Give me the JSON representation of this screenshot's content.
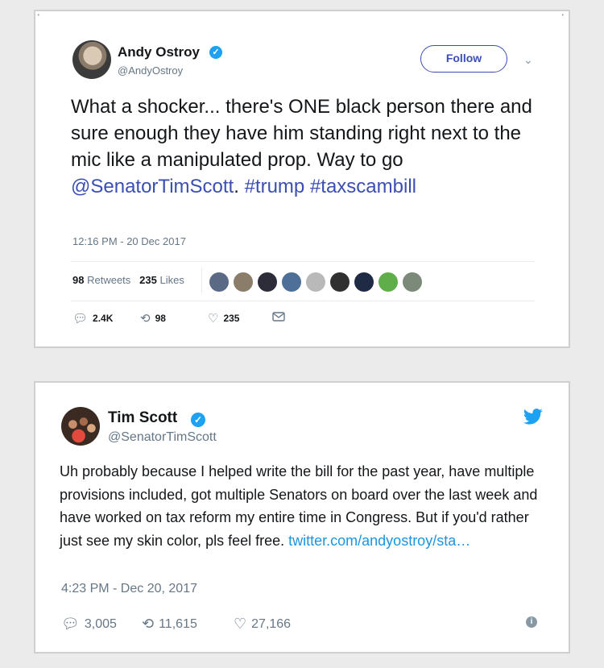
{
  "tweet1": {
    "name": "Andy Ostroy",
    "handle": "@AndyOstroy",
    "follow_label": "Follow",
    "text_plain": "What a shocker... there's ONE black person there and sure enough they have him standing right next to the mic like a manipulated prop. Way to go ",
    "mention": "@SenatorTimScott",
    "text_sep": ". ",
    "hashtag1": "#trump",
    "hashtag2": "#taxscambill",
    "timestamp": "12:16 PM - 20 Dec 2017",
    "retweets_count": "98",
    "retweets_label": "Retweets",
    "likes_count": "235",
    "likes_label": "Likes",
    "actions": {
      "replies": "2.4K",
      "retweets": "98",
      "likes": "235"
    },
    "liker_avatar_colors": [
      "#5a6a85",
      "#8a7d6a",
      "#2d2d3a",
      "#4d6f98",
      "#b9b9b9",
      "#303030",
      "#1f2a44",
      "#5fae4a",
      "#7c8a7a"
    ]
  },
  "tweet2": {
    "name": "Tim Scott",
    "handle": "@SenatorTimScott",
    "text": "Uh probably because I helped write the bill for the past year, have multiple provisions included, got multiple Senators on board over the last week and have worked on tax reform my entire time in Congress. But if you'd rather just see my skin color, pls feel free. ",
    "link": "twitter.com/andyostroy/sta…",
    "timestamp": "4:23 PM - Dec 20, 2017",
    "actions": {
      "replies": "3,005",
      "retweets": "11,615",
      "likes": "27,166"
    }
  },
  "icons": {
    "verified": "verified-badge-icon",
    "reply": "reply-icon",
    "retweet": "retweet-icon",
    "like": "heart-icon",
    "dm": "envelope-icon",
    "twitter": "twitter-bird-icon",
    "info": "info-icon"
  },
  "colors": {
    "twitter_blue": "#1da1f2",
    "link_purple": "#3b4eb5",
    "link_blue": "#1b95e0",
    "muted": "#657786"
  }
}
